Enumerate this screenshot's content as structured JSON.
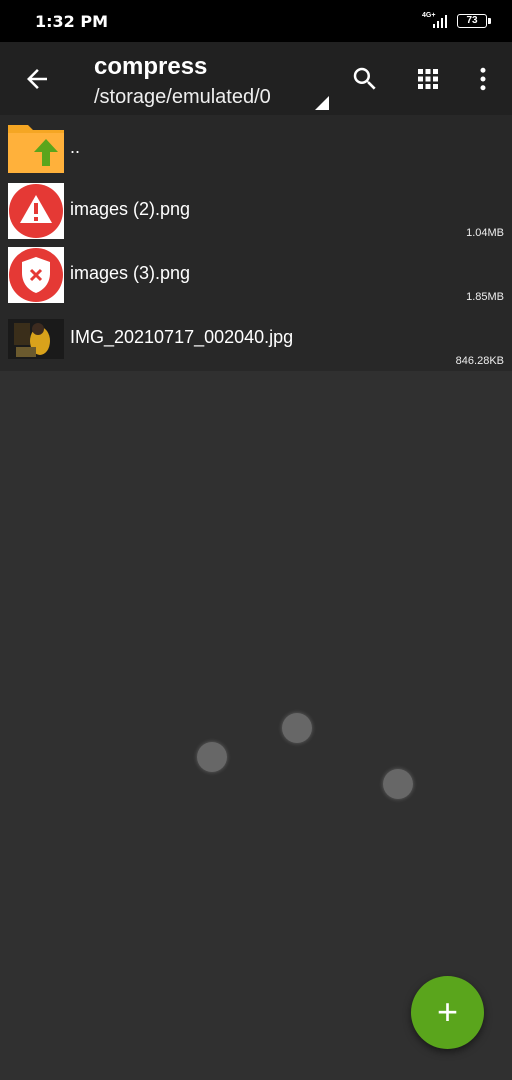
{
  "status": {
    "time": "1:32 PM",
    "network": "4G+",
    "battery": "73"
  },
  "toolbar": {
    "title": "compress",
    "path": "/storage/emulated/0",
    "icons": [
      "back-arrow-icon",
      "search-icon",
      "grid-view-icon",
      "more-vert-icon"
    ]
  },
  "files": [
    {
      "name": "..",
      "size": "",
      "icon": "folder-up-icon"
    },
    {
      "name": "images (2).png",
      "size": "1.04MB",
      "icon": "warning-icon"
    },
    {
      "name": "images (3).png",
      "size": "1.85MB",
      "icon": "shield-error-icon"
    },
    {
      "name": "IMG_20210717_002040.jpg",
      "size": "846.28KB",
      "icon": "photo-thumbnail"
    }
  ],
  "fab": {
    "label": "+"
  },
  "colors": {
    "accent": "#5aa51c",
    "background": "#303030",
    "toolbar": "#212121",
    "row": "#282828",
    "folder": "#f5a623",
    "alert_red": "#e53935"
  }
}
